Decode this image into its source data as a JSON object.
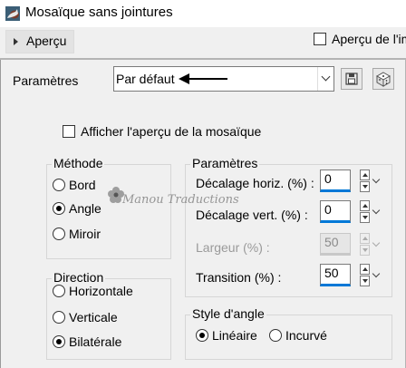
{
  "window": {
    "title": "Mosaïque sans jointures"
  },
  "toolbar": {
    "apercu_label": "Aperçu",
    "apercu_im_label": "Aperçu de l'im"
  },
  "presets": {
    "label": "Paramètres",
    "value": "Par défaut"
  },
  "preview_checkbox": {
    "label": "Afficher l'aperçu de la mosaïque",
    "checked": false
  },
  "methode": {
    "legend": "Méthode",
    "options": [
      {
        "label": "Bord",
        "selected": false
      },
      {
        "label": "Angle",
        "selected": true
      },
      {
        "label": "Miroir",
        "selected": false
      }
    ]
  },
  "direction": {
    "legend": "Direction",
    "options": [
      {
        "label": "Horizontale",
        "selected": false
      },
      {
        "label": "Verticale",
        "selected": false
      },
      {
        "label": "Bilatérale",
        "selected": true
      }
    ]
  },
  "parametres": {
    "legend": "Paramètres",
    "fields": [
      {
        "label": "Décalage horiz. (%) :",
        "value": "0",
        "enabled": true
      },
      {
        "label": "Décalage vert. (%) :",
        "value": "0",
        "enabled": true
      },
      {
        "label": "Largeur (%) :",
        "value": "50",
        "enabled": false
      },
      {
        "label": "Transition (%) :",
        "value": "50",
        "enabled": true
      }
    ]
  },
  "style_angle": {
    "legend": "Style d'angle",
    "options": [
      {
        "label": "Linéaire",
        "selected": true
      },
      {
        "label": "Incurvé",
        "selected": false
      }
    ]
  },
  "watermark": {
    "text": "Manou Traductions"
  }
}
